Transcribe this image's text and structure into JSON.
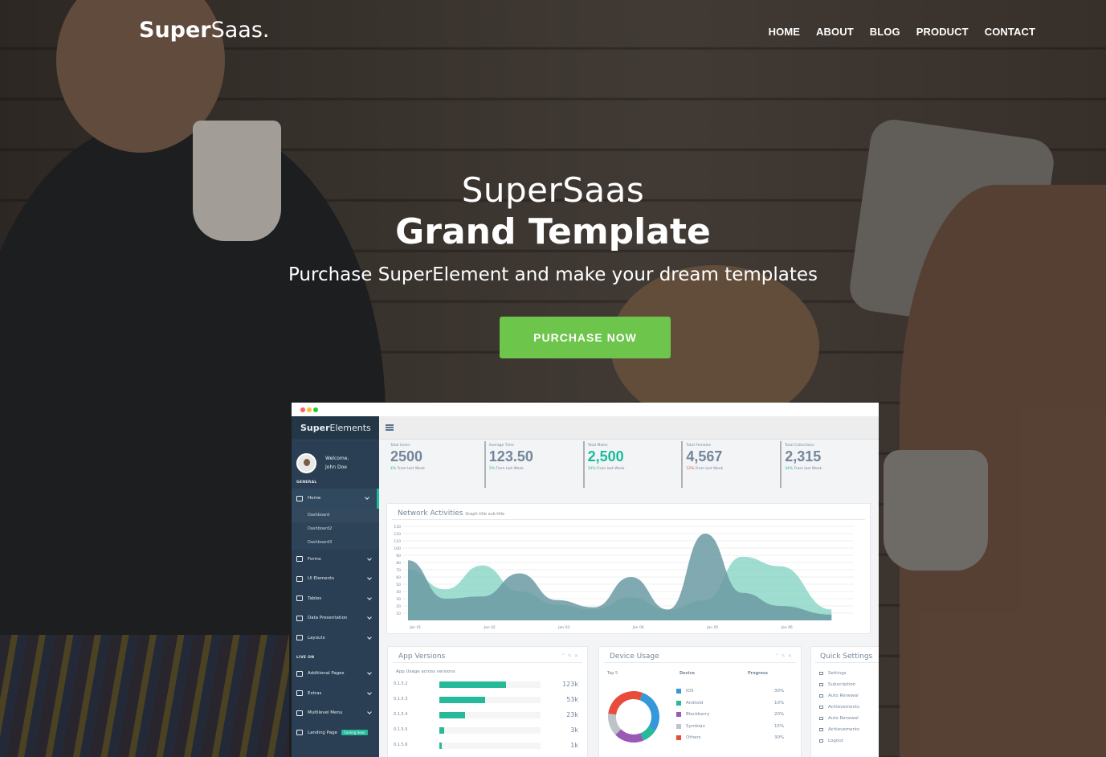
{
  "nav": {
    "logo_bold": "Super",
    "logo_light": "Saas.",
    "links": [
      "HOME",
      "ABOUT",
      "BLOG",
      "PRODUCT",
      "CONTACT"
    ]
  },
  "hero": {
    "subtitle": "SuperSaas",
    "title": "Grand Template",
    "tagline": "Purchase SuperElement and make your dream templates",
    "cta": "PURCHASE NOW",
    "cta_color": "#6dc54b"
  },
  "mock": {
    "brand_bold": "Super",
    "brand_light": "Elements",
    "welcome": "Welcome,",
    "user": "John Doe",
    "section_general": "GENERAL",
    "section_live": "LIVE ON",
    "menu_general": [
      {
        "label": "Home",
        "icon": "home-icon"
      },
      {
        "label": "Forms",
        "icon": "edit-icon"
      },
      {
        "label": "UI Elements",
        "icon": "desktop-icon"
      },
      {
        "label": "Tables",
        "icon": "table-icon"
      },
      {
        "label": "Data Presentation",
        "icon": "bar-chart-icon"
      },
      {
        "label": "Layouts",
        "icon": "clone-icon"
      }
    ],
    "submenu": [
      "Dashboard",
      "Dashboard2",
      "Dashboard3"
    ],
    "menu_live": [
      {
        "label": "Additional Pages",
        "icon": "bug-icon"
      },
      {
        "label": "Extras",
        "icon": "windows-icon"
      },
      {
        "label": "Multilevel Menu",
        "icon": "sitemap-icon"
      },
      {
        "label": "Landing Page",
        "icon": "laptop-icon",
        "badge": "Coming Soon"
      }
    ],
    "stats": [
      {
        "label": "Total Users",
        "value": "2500",
        "sub_a": "4%",
        "sub_b": " From last Week",
        "color": "gray"
      },
      {
        "label": "Average Time",
        "value": "123.50",
        "sub_a": "3%",
        "sub_b": " From last Week",
        "color": "gray"
      },
      {
        "label": "Total Males",
        "value": "2,500",
        "sub_a": "34%",
        "sub_b": " From last Week",
        "color": "green"
      },
      {
        "label": "Total Females",
        "value": "4,567",
        "sub_a": "12%",
        "sub_b": " From last Week",
        "color": "gray"
      },
      {
        "label": "Total Collections",
        "value": "2,315",
        "sub_a": "34%",
        "sub_b": " From last Week",
        "color": "gray"
      }
    ],
    "network_title": "Network Activities",
    "network_sub": "Graph title sub-title",
    "app_versions_title": "App Versions",
    "app_usage_label": "App Usage across versions",
    "device_usage_title": "Device Usage",
    "device_top": "Top 5",
    "device_col": "Device",
    "progress_col": "Progress",
    "quick_title": "Quick Settings",
    "quick_items": [
      "Settings",
      "Subscription",
      "Auto Renewal",
      "Achievements",
      "Auto Renewal",
      "Achievements",
      "Logout"
    ]
  },
  "chart_data": [
    {
      "type": "area",
      "title": "Network Activities",
      "subtitle": "Graph title sub-title",
      "categories": [
        "Jan 01",
        "Jan 02",
        "Jan 03",
        "Jan 04",
        "Jan 05",
        "Jan 06"
      ],
      "ylim": [
        0,
        130
      ],
      "yticks": [
        10,
        20,
        30,
        40,
        50,
        60,
        70,
        80,
        90,
        100,
        110,
        120,
        130
      ],
      "series": [
        {
          "color": "#7fd1c0",
          "x": [
            0,
            0.5,
            1,
            1.5,
            2,
            2.5,
            3,
            3.5,
            4,
            4.5,
            5,
            5.7
          ],
          "values": [
            70,
            43,
            76,
            40,
            22,
            15,
            32,
            15,
            28,
            88,
            75,
            15
          ]
        },
        {
          "color": "#6b9aa3",
          "x": [
            0,
            0.5,
            1,
            1.5,
            2,
            2.5,
            3,
            3.5,
            4,
            4.5,
            5,
            5.7
          ],
          "values": [
            83,
            30,
            33,
            65,
            28,
            18,
            60,
            15,
            120,
            38,
            20,
            8
          ]
        }
      ],
      "grid": true
    },
    {
      "type": "bar",
      "title": "App Usage across versions",
      "categories": [
        "0.1.5.2",
        "0.1.5.3",
        "0.1.5.4",
        "0.1.5.5",
        "0.1.5.6"
      ],
      "values": [
        66,
        45,
        25,
        5,
        2
      ],
      "labels": [
        "123k",
        "53k",
        "23k",
        "3k",
        "1k"
      ],
      "ylim": [
        0,
        100
      ]
    },
    {
      "type": "pie",
      "title": "Device Usage",
      "categories": [
        "IOS",
        "Android",
        "Blackberry",
        "Symbian",
        "Others"
      ],
      "values": [
        30,
        10,
        20,
        15,
        30
      ],
      "labels": [
        "30%",
        "10%",
        "20%",
        "15%",
        "30%"
      ],
      "colors": [
        "#3498db",
        "#26b99a",
        "#9b59b6",
        "#bdc3c7",
        "#e74c3c"
      ]
    }
  ]
}
